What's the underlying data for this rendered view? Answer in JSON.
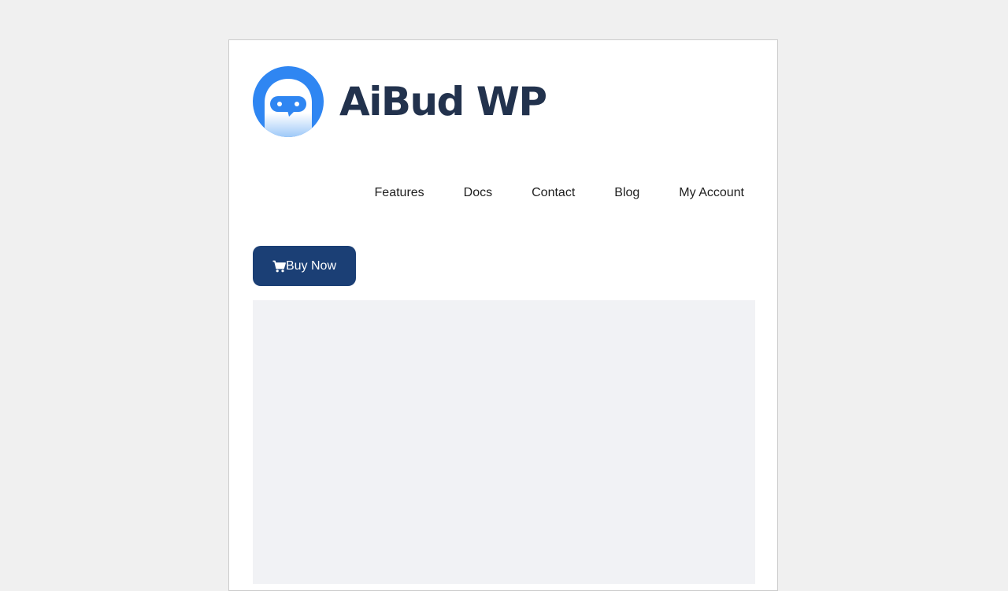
{
  "brand": {
    "name": "AiBud WP",
    "logo_icon": "robot-chat-icon",
    "colors": {
      "logo_blue": "#2f86f2",
      "logo_light": "#8ec0f7",
      "text": "#22324d"
    }
  },
  "nav": {
    "items": [
      {
        "label": "Features"
      },
      {
        "label": "Docs"
      },
      {
        "label": "Contact"
      },
      {
        "label": "Blog"
      },
      {
        "label": "My Account"
      }
    ]
  },
  "cta": {
    "label": "Buy Now",
    "icon": "cart-icon",
    "color": "#1b3f75"
  }
}
